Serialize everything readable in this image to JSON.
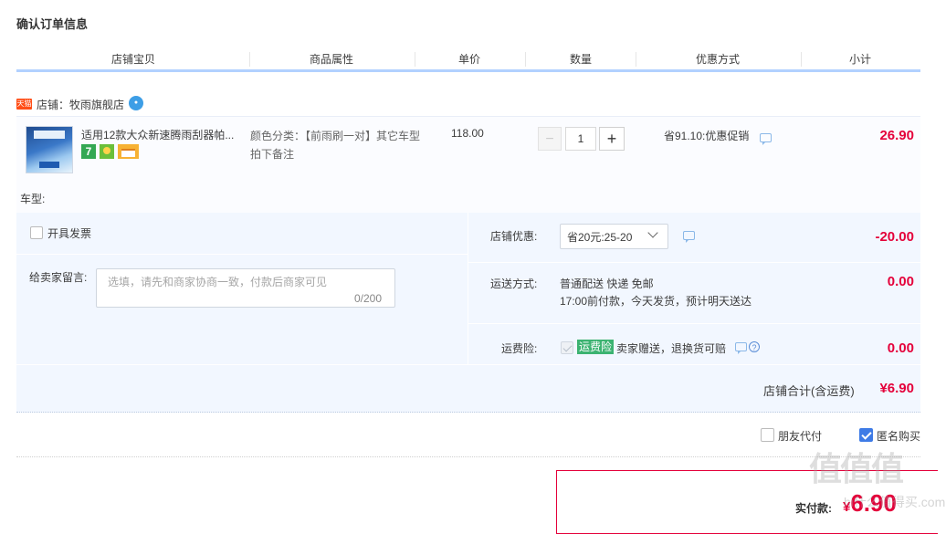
{
  "page_title": "确认订单信息",
  "columns": [
    "店铺宝贝",
    "商品属性",
    "单价",
    "数量",
    "优惠方式",
    "小计"
  ],
  "shop": {
    "tag": "天猫",
    "label": "店铺：牧雨旗舰店"
  },
  "item": {
    "title": "适用12款大众新速腾雨刮器帕...",
    "attr": "颜色分类：【前雨刷一对】其它车型拍下备注",
    "price": "118.00",
    "quantity": "1",
    "promo": "省91.10:优惠促销",
    "subtotal": "26.90",
    "icon_badge": "7"
  },
  "car_type_label": "车型:",
  "invoice_label": "开具发票",
  "message": {
    "label": "给卖家留言:",
    "placeholder": "选填，请先和商家协商一致，付款后商家可见",
    "count": "0/200"
  },
  "shop_discount": {
    "label": "店铺优惠:",
    "selected": "省20元:25-20",
    "value": "-20.00"
  },
  "shipping": {
    "label": "运送方式:",
    "line1": "普通配送 快递 免邮",
    "line2": "17:00前付款，今天发货，预计明天送达",
    "value": "0.00"
  },
  "insurance": {
    "label": "运费险:",
    "badge": "运费险",
    "text": "卖家赠送，退换货可赔",
    "value": "0.00"
  },
  "shop_total": {
    "label": "店铺合计(含运费)",
    "value": "¥6.90"
  },
  "options": {
    "friend_pay": "朋友代付",
    "anonymous": "匿名购买"
  },
  "payment": {
    "label": "实付款:",
    "currency": "¥",
    "value": "6.90"
  },
  "watermark": {
    "logo": "值值值",
    "url": "hi什么值得买.com"
  },
  "colors": {
    "accent_red": "#e4003a",
    "header_line": "#b2d1ff",
    "panel_bg": "#f2f7ff"
  }
}
